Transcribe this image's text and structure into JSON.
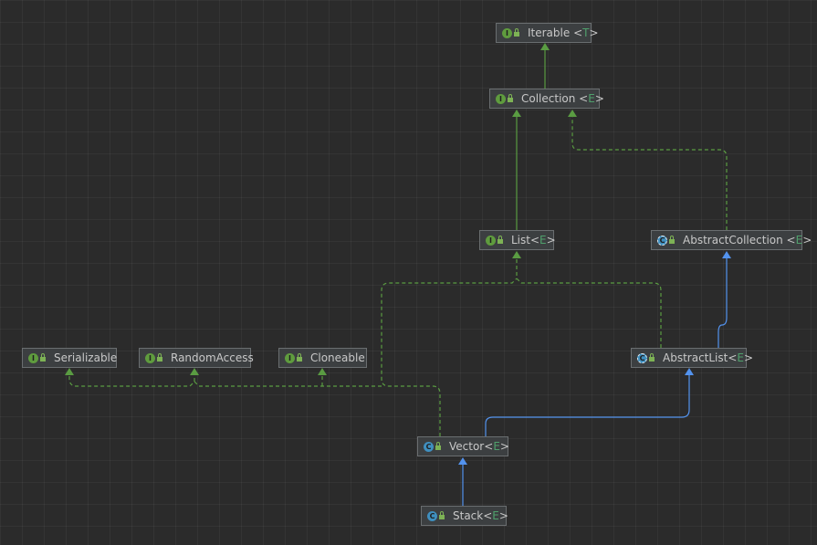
{
  "colors": {
    "background": "#2b2b2b",
    "node_fill": "#3c3f41",
    "node_border": "#6a6e70",
    "implements_edge": "#5a9c42",
    "extends_edge": "#5393ee",
    "interface_icon": "#5f9c3e",
    "class_icon": "#3f8fbf",
    "type_param": "#4fa06c"
  },
  "nodes": {
    "iterable": {
      "name": "Iterable",
      "sep": " <",
      "tp": "T",
      "close": ">",
      "kind": "interface",
      "badge": "I"
    },
    "collection": {
      "name": "Collection",
      "sep": " <",
      "tp": "E",
      "close": ">",
      "kind": "interface",
      "badge": "I"
    },
    "list": {
      "name": "List",
      "sep": "<",
      "tp": "E",
      "close": ">",
      "kind": "interface",
      "badge": "I"
    },
    "abstract_collection": {
      "name": "AbstractCollection",
      "sep": " <",
      "tp": "E",
      "close": ">",
      "kind": "abstract",
      "badge": "C"
    },
    "serializable": {
      "name": "Serializable",
      "kind": "interface",
      "badge": "I"
    },
    "random_access": {
      "name": "RandomAccess",
      "kind": "interface",
      "badge": "I"
    },
    "cloneable": {
      "name": "Cloneable",
      "kind": "interface",
      "badge": "I"
    },
    "abstract_list": {
      "name": "AbstractList",
      "sep": "<",
      "tp": "E",
      "close": ">",
      "kind": "abstract",
      "badge": "C"
    },
    "vector": {
      "name": "Vector",
      "sep": "<",
      "tp": "E",
      "close": ">",
      "kind": "class",
      "badge": "C"
    },
    "stack": {
      "name": "Stack",
      "sep": "<",
      "tp": "E",
      "close": ">",
      "kind": "class",
      "badge": "C"
    }
  }
}
